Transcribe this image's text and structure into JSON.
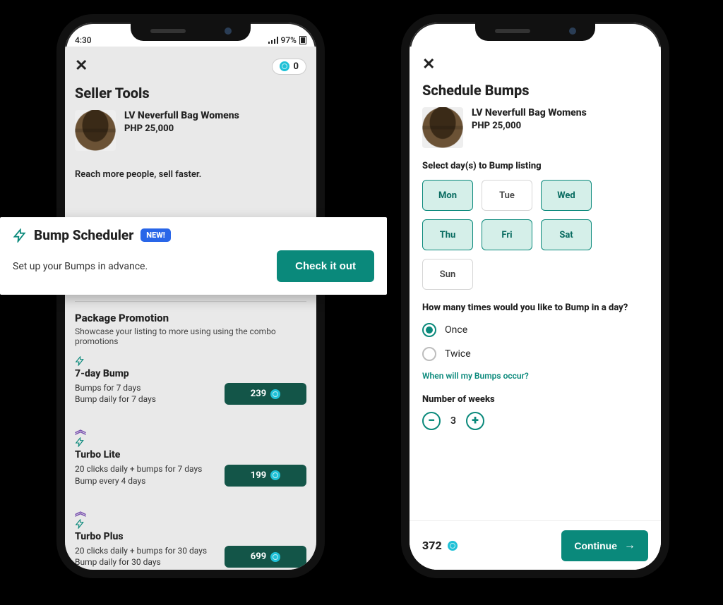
{
  "status": {
    "time": "4:30",
    "battery": "97%"
  },
  "screen1": {
    "coin_balance": "0",
    "title": "Seller Tools",
    "product": {
      "name": "LV Neverfull Bag Womens",
      "price": "PHP 25,000"
    },
    "tagline": "Reach more people, sell faster.",
    "callout": {
      "title": "Bump Scheduler",
      "badge": "NEW!",
      "subtitle": "Set up your Bumps in advance.",
      "cta": "Check it out"
    },
    "package_section": {
      "title": "Package Promotion",
      "subtitle": "Showcase your listing to more using using the combo promotions",
      "items": [
        {
          "name": "7-day Bump",
          "line1": "Bumps for 7 days",
          "line2": "Bump daily for 7 days",
          "price": "239"
        },
        {
          "name": "Turbo Lite",
          "line1": "20 clicks daily + bumps for 7 days",
          "line2": "Bump every 4 days",
          "price": "199"
        },
        {
          "name": "Turbo Plus",
          "line1": "20 clicks daily + bumps for 30 days",
          "line2": "Bump daily for 30 days",
          "price": "699"
        }
      ]
    }
  },
  "screen2": {
    "title": "Schedule Bumps",
    "product": {
      "name": "LV Neverfull Bag Womens",
      "price": "PHP 25,000"
    },
    "days_label": "Select day(s) to Bump listing",
    "days": [
      {
        "label": "Mon",
        "selected": true
      },
      {
        "label": "Tue",
        "selected": false
      },
      {
        "label": "Wed",
        "selected": true
      },
      {
        "label": "Thu",
        "selected": true
      },
      {
        "label": "Fri",
        "selected": true
      },
      {
        "label": "Sat",
        "selected": true
      },
      {
        "label": "Sun",
        "selected": false
      }
    ],
    "freq_label": "How many times would you like to Bump in a day?",
    "freq_options": [
      {
        "label": "Once",
        "selected": true
      },
      {
        "label": "Twice",
        "selected": false
      }
    ],
    "help_link": "When will my Bumps occur?",
    "weeks_label": "Number of weeks",
    "weeks_value": "3",
    "total_coins": "372",
    "continue": "Continue"
  }
}
